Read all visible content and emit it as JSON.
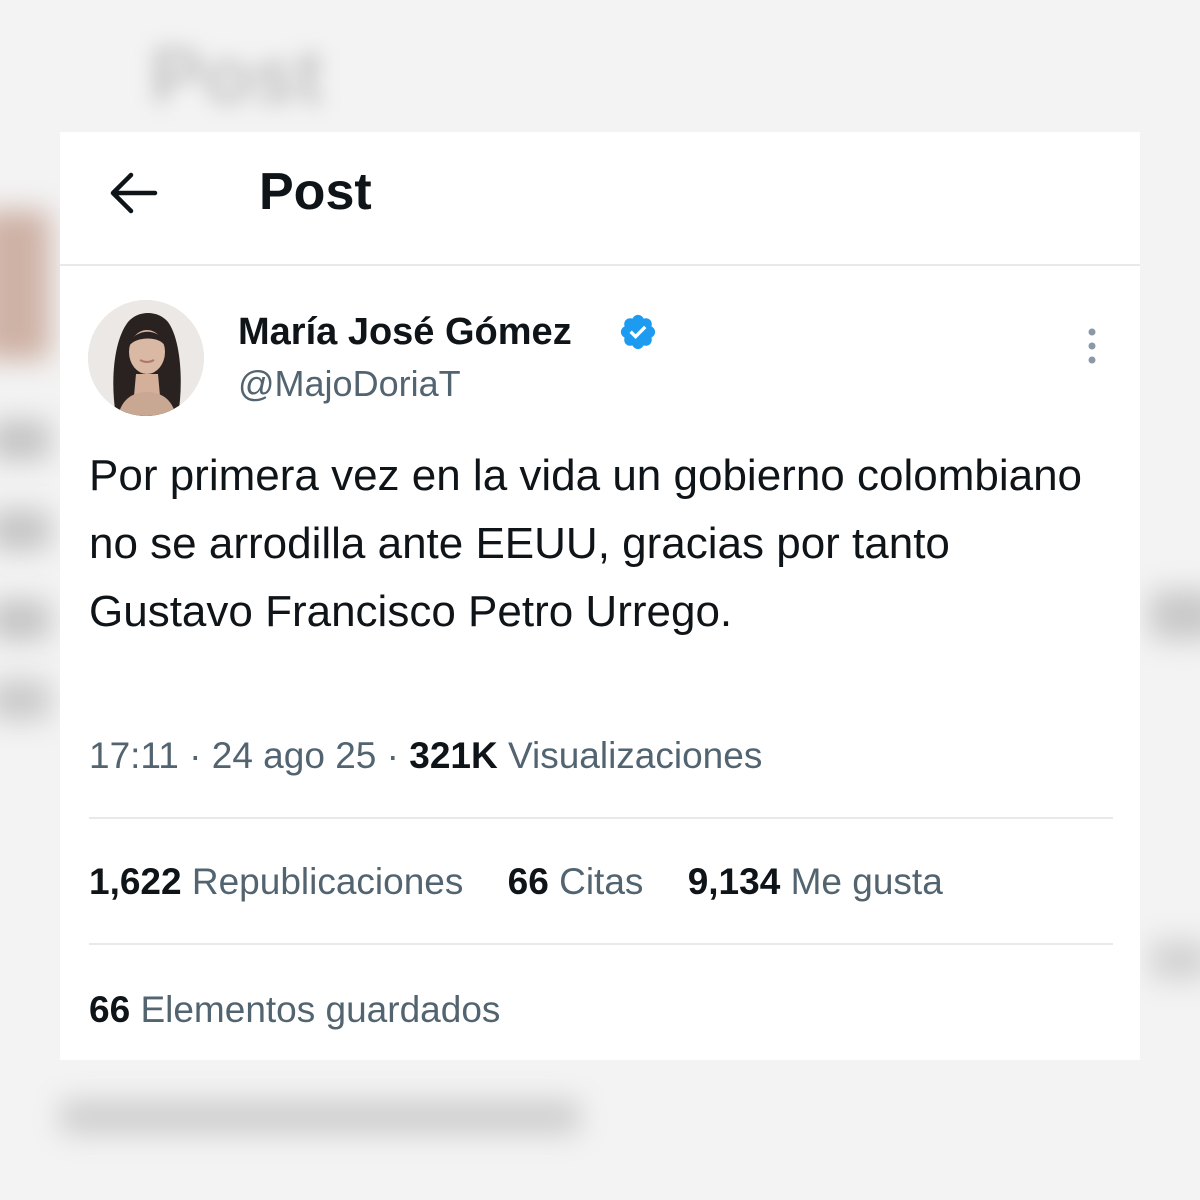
{
  "background": {
    "blurred_title": "Post"
  },
  "header": {
    "back_icon": "arrow-left-icon",
    "title": "Post"
  },
  "author": {
    "display_name": "María José Gómez",
    "handle": "@MajoDoriaT",
    "verified_icon": "verified-badge-icon",
    "verified_color": "#1d9bf0"
  },
  "more_icon": "more-vertical-icon",
  "post": {
    "text": "Por primera vez en la vida un gobierno colombiano no se arrodilla ante EEUU, gracias por tanto Gustavo Francisco Petro Urrego.",
    "time": "17:11",
    "date": "24 ago 25",
    "views_count": "321K",
    "views_label": "Visualizaciones"
  },
  "stats": {
    "reposts_count": "1,622",
    "reposts_label": "Republicaciones",
    "quotes_count": "66",
    "quotes_label": "Citas",
    "likes_count": "9,134",
    "likes_label": "Me gusta"
  },
  "bookmarks": {
    "count": "66",
    "label": "Elementos guardados"
  },
  "colors": {
    "text_primary": "#0f1419",
    "text_secondary": "#536471",
    "divider": "#e7e9ea"
  }
}
